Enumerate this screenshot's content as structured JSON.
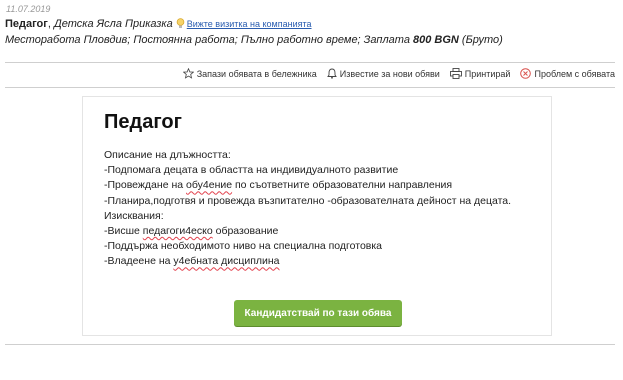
{
  "listing": {
    "date": "11.07.2019",
    "job_title": "Педагог",
    "company_name": "Детска Ясла Приказка",
    "company_link": "Вижте визитка на компанията",
    "details_prefix": "Месторабота Пловдив; Постоянна работа; Пълно работно време; Заплата ",
    "salary": "800 BGN",
    "salary_suffix": " (Бруто)"
  },
  "toolbar": {
    "save": "Запази обявата в бележника",
    "notify": "Известие за нови обяви",
    "print": "Принтирай",
    "report": "Проблем с обявата"
  },
  "ad": {
    "title": "Педагог",
    "description_heading": "Описание на длъжността:",
    "duty_1": "-Подпомага децата в областта на индивидуалното развитие",
    "duty_2_pre": "-Провеждане на ",
    "duty_2_word": "обу4ение",
    "duty_2_post": " по съответните образователни направления",
    "duty_3": "-Планира,подготвя и провежда възпитателно -образователната дейност на децата.",
    "requirements_heading": "Изисквания:",
    "req_1_pre": "-Висше ",
    "req_1_word": "педагоги4еско",
    "req_1_post": " образование",
    "req_2": "-Поддържа необходимото ниво на специална подготовка",
    "req_3_pre": "-Владеене на ",
    "req_3_word": "у4ебната дисциплина",
    "apply_label": "Кандидатствай по тази обява"
  },
  "colors": {
    "apply_button": "#7bb341",
    "link": "#2a5db0",
    "spellcheck_underline": "#e2414d",
    "report_icon": "#d9534f"
  }
}
